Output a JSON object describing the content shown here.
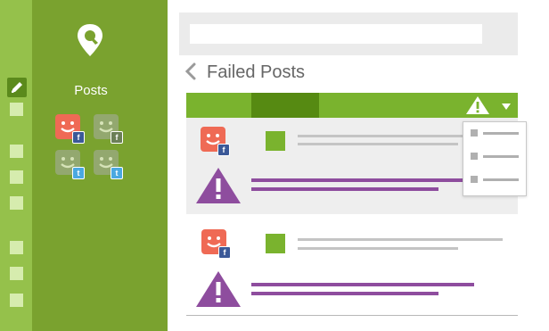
{
  "sidebar": {
    "title": "Posts",
    "edit_icon": "pencil-icon",
    "items_count_visual": 9
  },
  "search": {
    "value": "",
    "placeholder": ""
  },
  "header": {
    "title": "Failed Posts",
    "back_icon": "chevron-left-icon"
  },
  "toolbar": {
    "warning_icon": "warning-icon",
    "dropdown_icon": "caret-down-icon"
  },
  "accounts": [
    {
      "network": "facebook",
      "badge": "f",
      "active": true
    },
    {
      "network": "facebook",
      "badge": "f",
      "active": false
    },
    {
      "network": "twitter",
      "badge": "t",
      "active": false
    },
    {
      "network": "twitter",
      "badge": "t",
      "active": false
    }
  ],
  "posts": [
    {
      "network": "facebook",
      "badge": "f",
      "status": "failed"
    },
    {
      "network": "facebook",
      "badge": "f",
      "status": "failed"
    }
  ],
  "colors": {
    "rail": "#95c14b",
    "panel": "#7aa22f",
    "accent_green": "#7ab32e",
    "accent_dark": "#568a12",
    "error_purple": "#8e4d9e",
    "avatar_red": "#ef6a55"
  }
}
